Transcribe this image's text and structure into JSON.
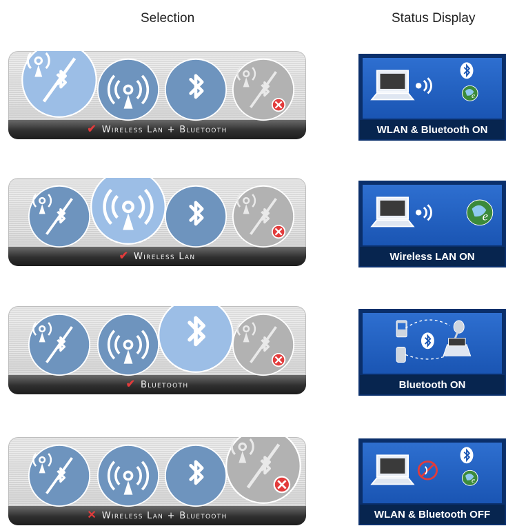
{
  "headings": {
    "selection": "Selection",
    "status": "Status Display"
  },
  "rows": [
    {
      "selected": "wlan-bluetooth",
      "selected_mark": "✔",
      "label": "Wireless Lan + Bluetooth",
      "status_label": "WLAN & Bluetooth ON",
      "status_icons": [
        "laptop-icon",
        "signal-waves-icon",
        "bluetooth-icon",
        "globe-icon"
      ]
    },
    {
      "selected": "wlan",
      "selected_mark": "✔",
      "label": "Wireless Lan",
      "status_label": "Wireless LAN ON",
      "status_icons": [
        "laptop-icon",
        "signal-waves-icon",
        "globe-icon"
      ]
    },
    {
      "selected": "bluetooth",
      "selected_mark": "✔",
      "label": "Bluetooth",
      "status_label": "Bluetooth ON",
      "status_icons": [
        "phone-icon",
        "bluetooth-icon",
        "headset-icon",
        "laptop-icon"
      ]
    },
    {
      "selected": "off",
      "selected_mark": "✕",
      "label": "Wireless Lan + Bluetooth",
      "status_label": "WLAN & Bluetooth OFF",
      "status_icons": [
        "laptop-icon",
        "no-signal-icon",
        "bluetooth-icon",
        "globe-icon"
      ]
    }
  ],
  "colors": {
    "orb_blue": "#5b86b6",
    "orb_selected": "#8fb6e3",
    "orb_off": "#a8a8a8",
    "accent_red": "#e23b3b",
    "status_bg": "#0a2f6b",
    "status_screen": "#2e6fd0"
  }
}
